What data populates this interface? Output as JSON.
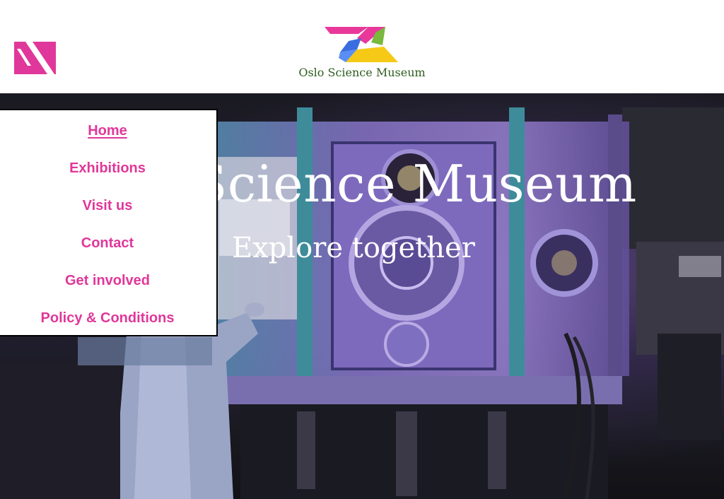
{
  "header": {
    "menu_icon": "menu-toggle-icon",
    "logo_icon": "oslo-science-museum-logo",
    "logo_name": "Oslo Science Museum"
  },
  "hero": {
    "title": "Science Museum",
    "subtitle": "Explore together",
    "image": "laboratory-machinery-photo"
  },
  "nav": {
    "items": [
      {
        "label": "Home",
        "active": true
      },
      {
        "label": "Exhibitions",
        "active": false
      },
      {
        "label": "Visit us",
        "active": false
      },
      {
        "label": "Contact",
        "active": false
      },
      {
        "label": "Get involved",
        "active": false
      },
      {
        "label": "Policy & Conditions",
        "active": false
      }
    ]
  },
  "colors": {
    "accent": "#e0379a",
    "logo_text": "#2e5e1e",
    "hero_text": "#ffffff",
    "drawer_bg": "#ffffff",
    "drawer_border": "#000000"
  }
}
